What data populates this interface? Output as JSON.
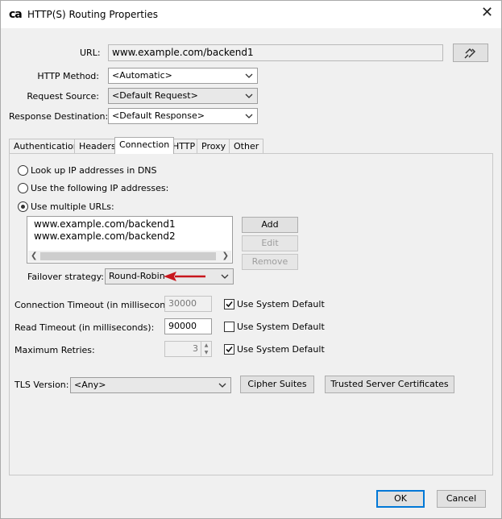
{
  "window": {
    "logo": "ca",
    "title": "HTTP(S) Routing Properties"
  },
  "form": {
    "url_label": "URL:",
    "url_value": "www.example.com/backend1",
    "http_method_label": "HTTP Method:",
    "http_method_value": "<Automatic>",
    "request_source_label": "Request Source:",
    "request_source_value": "<Default Request>",
    "response_destination_label": "Response Destination:",
    "response_destination_value": "<Default Response>"
  },
  "tabs": [
    "Authentication",
    "Headers",
    "Connection",
    "HTTP",
    "Proxy",
    "Other"
  ],
  "active_tab": "Connection",
  "connection": {
    "radio_dns": "Look up IP addresses in DNS",
    "radio_ips": "Use the following IP addresses:",
    "radio_multi": "Use multiple URLs:",
    "urls": [
      "www.example.com/backend1",
      "www.example.com/backend2"
    ],
    "add_button": "Add",
    "edit_button": "Edit",
    "remove_button": "Remove",
    "failover_label": "Failover strategy:",
    "failover_value": "Round-Robin",
    "connection_timeout_label": "Connection Timeout (in milliseconds):",
    "connection_timeout_value": "30000",
    "read_timeout_label": "Read Timeout (in milliseconds):",
    "read_timeout_value": "90000",
    "max_retries_label": "Maximum Retries:",
    "max_retries_value": "3",
    "use_system_default": "Use System Default",
    "connection_timeout_default_checked": true,
    "read_timeout_default_checked": false,
    "max_retries_default_checked": true,
    "tls_label": "TLS Version:",
    "tls_value": "<Any>",
    "cipher_suites_button": "Cipher Suites",
    "trusted_certs_button": "Trusted Server Certificates"
  },
  "footer": {
    "ok_button": "OK",
    "cancel_button": "Cancel"
  },
  "colors": {
    "annotation_arrow": "#c8161d",
    "focus_border": "#0078d7"
  }
}
